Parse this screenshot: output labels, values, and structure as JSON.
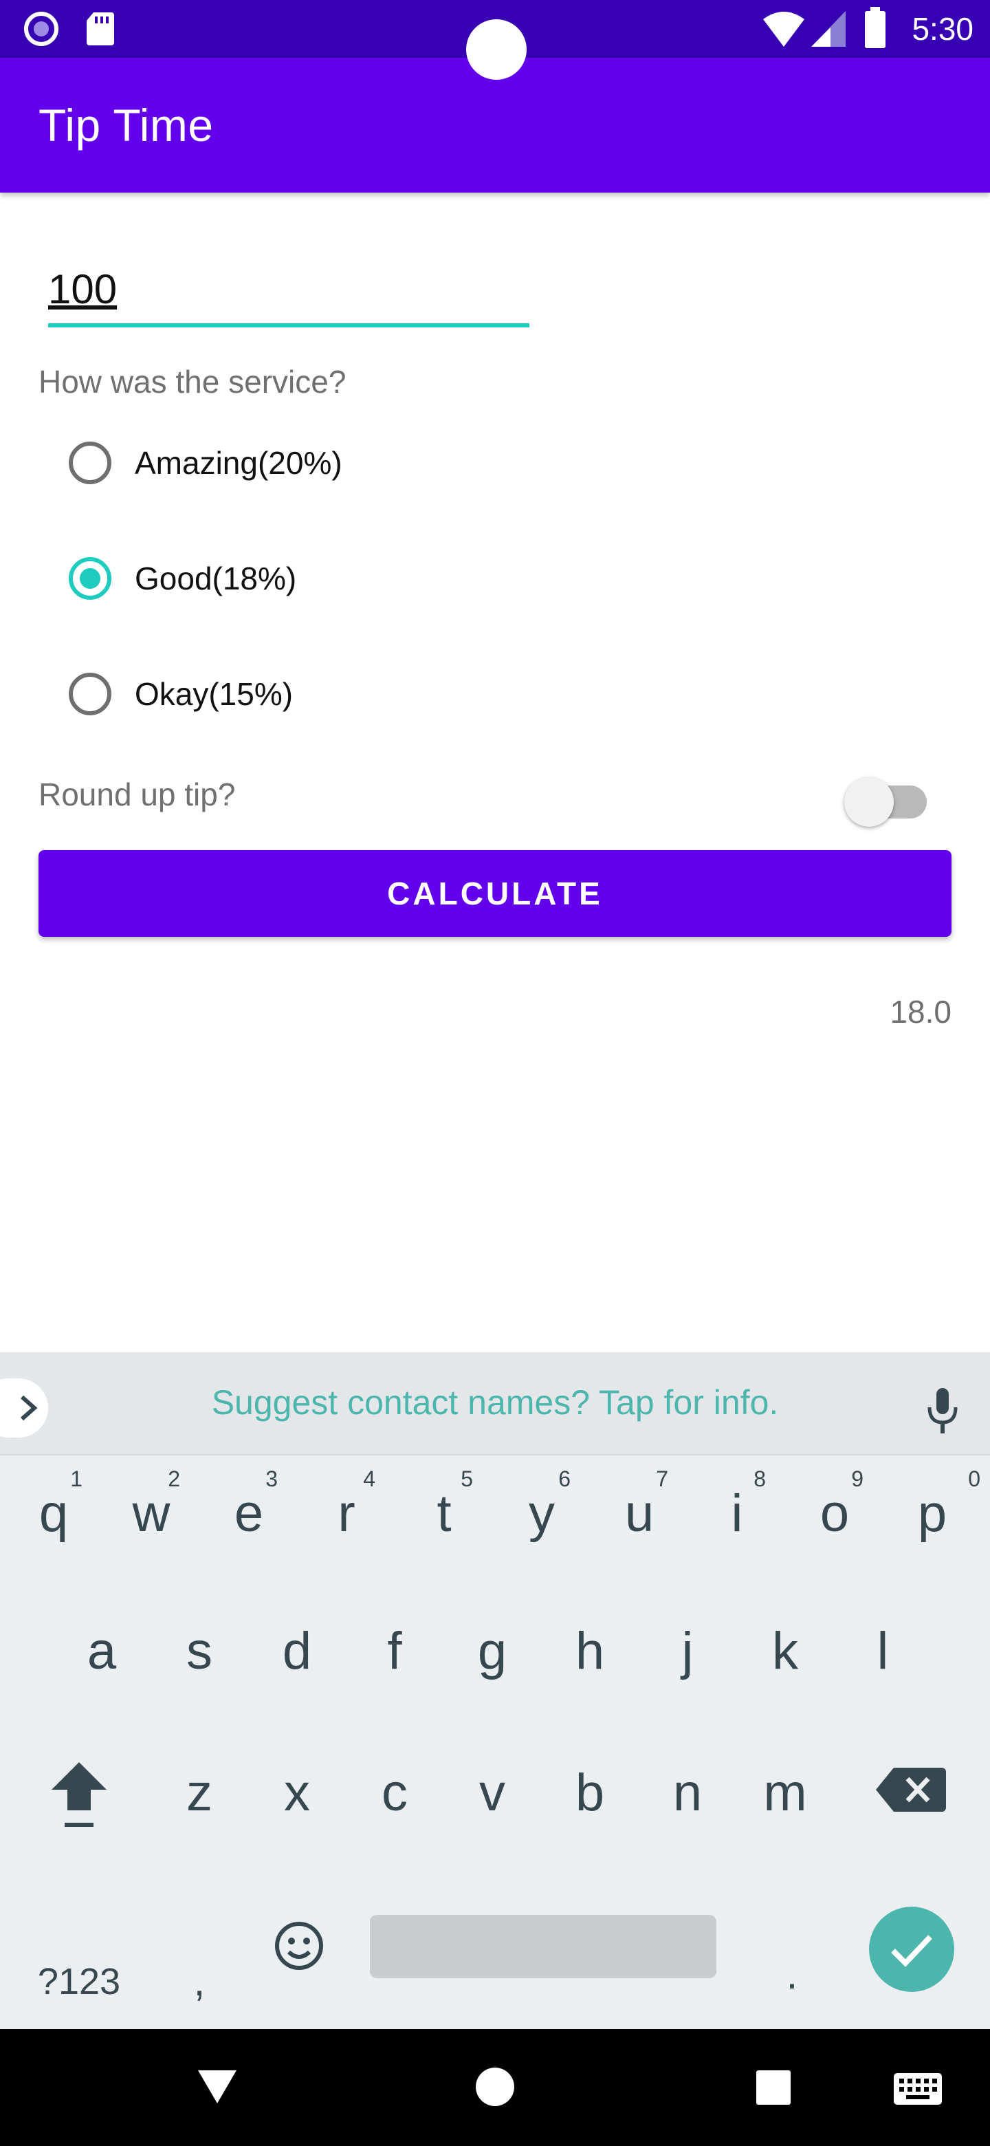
{
  "status_bar": {
    "time": "5:30",
    "icons": [
      "record-icon",
      "sd-card-icon",
      "wifi-icon",
      "signal-icon",
      "battery-icon"
    ]
  },
  "app_bar": {
    "title": "Tip Time"
  },
  "cost_input": {
    "value": "100"
  },
  "service": {
    "question": "How was the service?",
    "options": [
      {
        "label": "Amazing(20%)",
        "checked": false
      },
      {
        "label": "Good(18%)",
        "checked": true
      },
      {
        "label": "Okay(15%)",
        "checked": false
      }
    ]
  },
  "round_up": {
    "label": "Round up tip?",
    "on": false
  },
  "calculate_button": {
    "label": "CALCULATE"
  },
  "tip_result": "18.0",
  "keyboard": {
    "suggestion": "Suggest contact names? Tap for info.",
    "row1": [
      {
        "k": "q",
        "n": "1"
      },
      {
        "k": "w",
        "n": "2"
      },
      {
        "k": "e",
        "n": "3"
      },
      {
        "k": "r",
        "n": "4"
      },
      {
        "k": "t",
        "n": "5"
      },
      {
        "k": "y",
        "n": "6"
      },
      {
        "k": "u",
        "n": "7"
      },
      {
        "k": "i",
        "n": "8"
      },
      {
        "k": "o",
        "n": "9"
      },
      {
        "k": "p",
        "n": "0"
      }
    ],
    "row2": [
      "a",
      "s",
      "d",
      "f",
      "g",
      "h",
      "j",
      "k",
      "l"
    ],
    "row3": [
      "z",
      "x",
      "c",
      "v",
      "b",
      "n",
      "m"
    ],
    "symbols_label": "?123",
    "comma": ",",
    "period": "."
  },
  "colors": {
    "status_bar": "#3700B3",
    "primary": "#6200EE",
    "accent": "#1DCCBF",
    "keyboard_bg": "#ECEFF1",
    "suggestion_text": "#4DB6AC"
  }
}
